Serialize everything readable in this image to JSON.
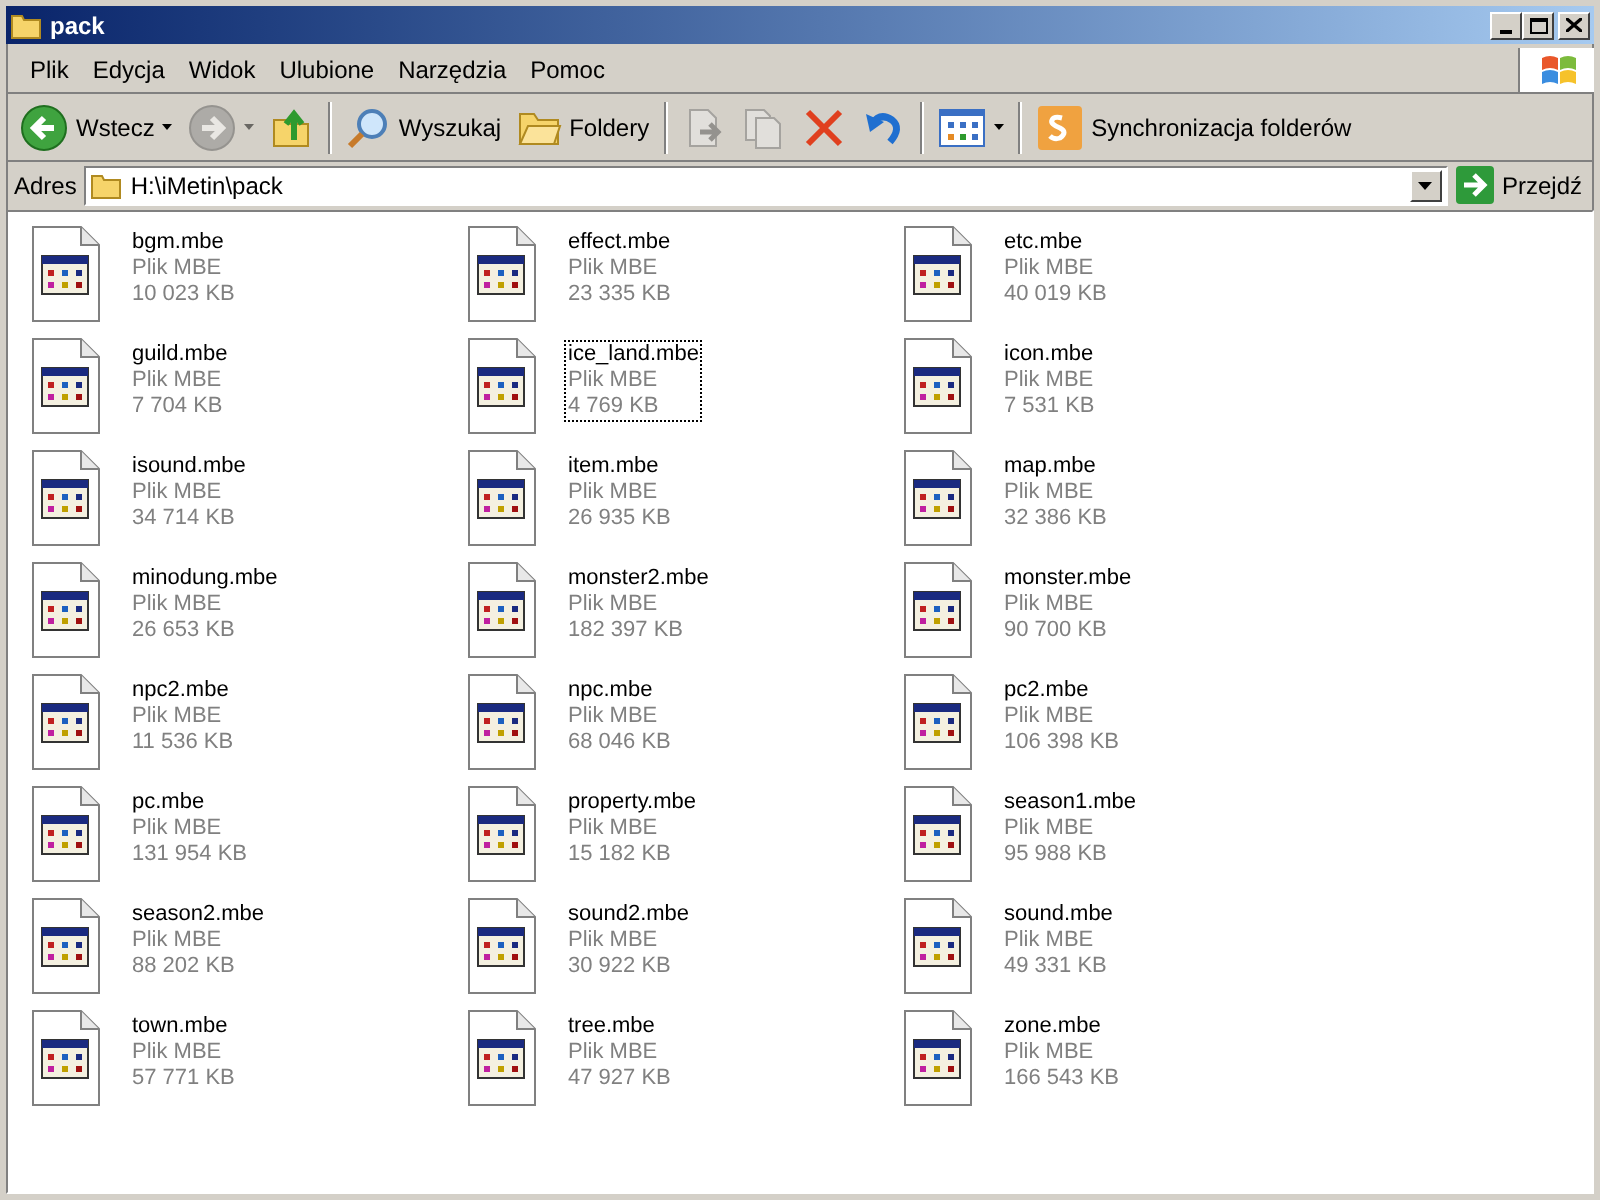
{
  "window": {
    "title": "pack"
  },
  "menu": [
    "Plik",
    "Edycja",
    "Widok",
    "Ulubione",
    "Narzędzia",
    "Pomoc"
  ],
  "toolbar": [
    {
      "kind": "back",
      "label": "Wstecz",
      "disabled": false
    },
    {
      "kind": "forward",
      "disabled": true
    },
    {
      "kind": "up",
      "disabled": false
    },
    {
      "kind": "separator"
    },
    {
      "kind": "search",
      "label": "Wyszukaj",
      "disabled": false
    },
    {
      "kind": "folders",
      "label": "Foldery",
      "disabled": false
    },
    {
      "kind": "separator"
    },
    {
      "kind": "move",
      "disabled": true
    },
    {
      "kind": "copy",
      "disabled": true
    },
    {
      "kind": "delete",
      "disabled": false
    },
    {
      "kind": "undo",
      "disabled": false
    },
    {
      "kind": "separator"
    },
    {
      "kind": "views",
      "disabled": false
    },
    {
      "kind": "separator"
    },
    {
      "kind": "sync",
      "label": "Synchronizacja folderów",
      "disabled": false
    }
  ],
  "address_bar": {
    "label": "Adres",
    "value": "H:\\iMetin\\pack",
    "go_label": "Przejdź"
  },
  "files": [
    {
      "name": "bgm.mbe",
      "type": "Plik MBE",
      "size": "10 023 KB",
      "focused": false
    },
    {
      "name": "effect.mbe",
      "type": "Plik MBE",
      "size": "23 335 KB",
      "focused": false
    },
    {
      "name": "etc.mbe",
      "type": "Plik MBE",
      "size": "40 019 KB",
      "focused": false
    },
    {
      "name": "guild.mbe",
      "type": "Plik MBE",
      "size": "7 704 KB",
      "focused": false
    },
    {
      "name": "ice_land.mbe",
      "type": "Plik MBE",
      "size": "4 769 KB",
      "focused": true
    },
    {
      "name": "icon.mbe",
      "type": "Plik MBE",
      "size": "7 531 KB",
      "focused": false
    },
    {
      "name": "isound.mbe",
      "type": "Plik MBE",
      "size": "34 714 KB",
      "focused": false
    },
    {
      "name": "item.mbe",
      "type": "Plik MBE",
      "size": "26 935 KB",
      "focused": false
    },
    {
      "name": "map.mbe",
      "type": "Plik MBE",
      "size": "32 386 KB",
      "focused": false
    },
    {
      "name": "minodung.mbe",
      "type": "Plik MBE",
      "size": "26 653 KB",
      "focused": false
    },
    {
      "name": "monster2.mbe",
      "type": "Plik MBE",
      "size": "182 397 KB",
      "focused": false
    },
    {
      "name": "monster.mbe",
      "type": "Plik MBE",
      "size": "90 700 KB",
      "focused": false
    },
    {
      "name": "npc2.mbe",
      "type": "Plik MBE",
      "size": "11 536 KB",
      "focused": false
    },
    {
      "name": "npc.mbe",
      "type": "Plik MBE",
      "size": "68 046 KB",
      "focused": false
    },
    {
      "name": "pc2.mbe",
      "type": "Plik MBE",
      "size": "106 398 KB",
      "focused": false
    },
    {
      "name": "pc.mbe",
      "type": "Plik MBE",
      "size": "131 954 KB",
      "focused": false
    },
    {
      "name": "property.mbe",
      "type": "Plik MBE",
      "size": "15 182 KB",
      "focused": false
    },
    {
      "name": "season1.mbe",
      "type": "Plik MBE",
      "size": "95 988 KB",
      "focused": false
    },
    {
      "name": "season2.mbe",
      "type": "Plik MBE",
      "size": "88 202 KB",
      "focused": false
    },
    {
      "name": "sound2.mbe",
      "type": "Plik MBE",
      "size": "30 922 KB",
      "focused": false
    },
    {
      "name": "sound.mbe",
      "type": "Plik MBE",
      "size": "49 331 KB",
      "focused": false
    },
    {
      "name": "town.mbe",
      "type": "Plik MBE",
      "size": "57 771 KB",
      "focused": false
    },
    {
      "name": "tree.mbe",
      "type": "Plik MBE",
      "size": "47 927 KB",
      "focused": false
    },
    {
      "name": "zone.mbe",
      "type": "Plik MBE",
      "size": "166 543 KB",
      "focused": false
    }
  ]
}
